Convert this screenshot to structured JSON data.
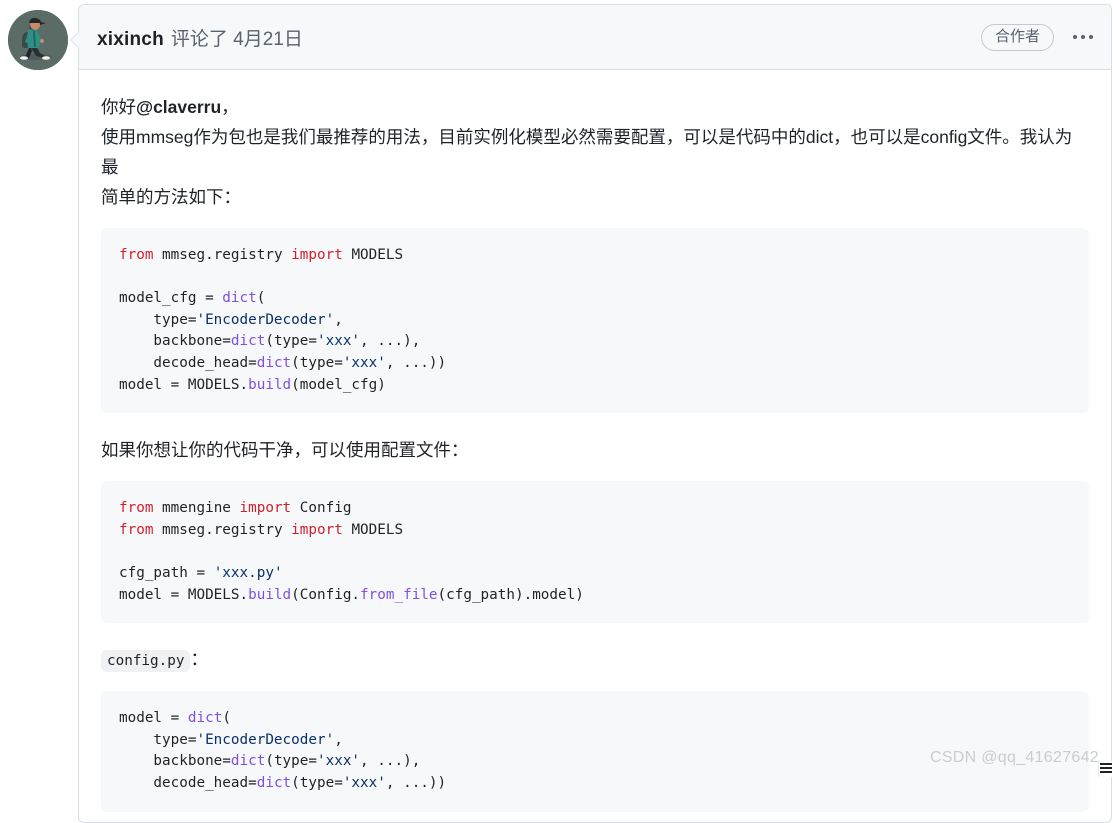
{
  "avatar": {
    "icon": "walking-person-avatar",
    "bg_color": "#5b6b66"
  },
  "header": {
    "author": "xixinch",
    "meta": "评论了 4月21日",
    "badge": "合作者",
    "menu_icon": "kebab-menu-icon"
  },
  "body": {
    "paragraph1_line1_prefix": "你好",
    "paragraph1_mention": "@claverru",
    "paragraph1_line1_suffix": "，",
    "paragraph1_line2": "使用mmseg作为包也是我们最推荐的用法，目前实例化模型必然需要配置，可以是代码中的dict，也可以是config文件。我认为最",
    "paragraph1_line3": "简单的方法如下：",
    "paragraph2": "如果你想让你的代码干净，可以使用配置文件：",
    "inline_code": "config.py",
    "inline_code_suffix": "："
  },
  "code_block_1": {
    "lines": [
      [
        {
          "t": "from ",
          "c": "kw"
        },
        {
          "t": "mmseg.registry ",
          "c": "txt"
        },
        {
          "t": "import ",
          "c": "kw"
        },
        {
          "t": "MODELS",
          "c": "txt"
        }
      ],
      [],
      [
        {
          "t": "model_cfg = ",
          "c": "txt"
        },
        {
          "t": "dict",
          "c": "fn"
        },
        {
          "t": "(",
          "c": "txt"
        }
      ],
      [
        {
          "t": "    type=",
          "c": "txt"
        },
        {
          "t": "'EncoderDecoder'",
          "c": "str"
        },
        {
          "t": ",",
          "c": "txt"
        }
      ],
      [
        {
          "t": "    backbone=",
          "c": "txt"
        },
        {
          "t": "dict",
          "c": "fn"
        },
        {
          "t": "(type=",
          "c": "txt"
        },
        {
          "t": "'xxx'",
          "c": "str"
        },
        {
          "t": ", ...),",
          "c": "txt"
        }
      ],
      [
        {
          "t": "    decode_head=",
          "c": "txt"
        },
        {
          "t": "dict",
          "c": "fn"
        },
        {
          "t": "(type=",
          "c": "txt"
        },
        {
          "t": "'xxx'",
          "c": "str"
        },
        {
          "t": ", ...))",
          "c": "txt"
        }
      ],
      [
        {
          "t": "model = MODELS.",
          "c": "txt"
        },
        {
          "t": "build",
          "c": "fn"
        },
        {
          "t": "(model_cfg)",
          "c": "txt"
        }
      ]
    ]
  },
  "code_block_2": {
    "lines": [
      [
        {
          "t": "from ",
          "c": "kw"
        },
        {
          "t": "mmengine ",
          "c": "txt"
        },
        {
          "t": "import ",
          "c": "kw"
        },
        {
          "t": "Config",
          "c": "txt"
        }
      ],
      [
        {
          "t": "from ",
          "c": "kw"
        },
        {
          "t": "mmseg.registry ",
          "c": "txt"
        },
        {
          "t": "import ",
          "c": "kw"
        },
        {
          "t": "MODELS",
          "c": "txt"
        }
      ],
      [],
      [
        {
          "t": "cfg_path = ",
          "c": "txt"
        },
        {
          "t": "'xxx.py'",
          "c": "str"
        }
      ],
      [
        {
          "t": "model = MODELS.",
          "c": "txt"
        },
        {
          "t": "build",
          "c": "fn"
        },
        {
          "t": "(Config.",
          "c": "txt"
        },
        {
          "t": "from_file",
          "c": "fn"
        },
        {
          "t": "(cfg_path).model)",
          "c": "txt"
        }
      ]
    ]
  },
  "code_block_3": {
    "lines": [
      [
        {
          "t": "model = ",
          "c": "txt"
        },
        {
          "t": "dict",
          "c": "fn"
        },
        {
          "t": "(",
          "c": "txt"
        }
      ],
      [
        {
          "t": "    type=",
          "c": "txt"
        },
        {
          "t": "'EncoderDecoder'",
          "c": "str"
        },
        {
          "t": ",",
          "c": "txt"
        }
      ],
      [
        {
          "t": "    backbone=",
          "c": "txt"
        },
        {
          "t": "dict",
          "c": "fn"
        },
        {
          "t": "(type=",
          "c": "txt"
        },
        {
          "t": "'xxx'",
          "c": "str"
        },
        {
          "t": ", ...),",
          "c": "txt"
        }
      ],
      [
        {
          "t": "    decode_head=",
          "c": "txt"
        },
        {
          "t": "dict",
          "c": "fn"
        },
        {
          "t": "(type=",
          "c": "txt"
        },
        {
          "t": "'xxx'",
          "c": "str"
        },
        {
          "t": ", ...))",
          "c": "txt"
        }
      ]
    ]
  },
  "watermark": "CSDN @qq_41627642",
  "colors": {
    "keyword": "#cf222e",
    "function": "#8250df",
    "string": "#0a3069",
    "text": "#1f2328",
    "code_bg": "#f6f8fa",
    "header_bg": "#f6f8fa",
    "border": "#d8dee4"
  }
}
